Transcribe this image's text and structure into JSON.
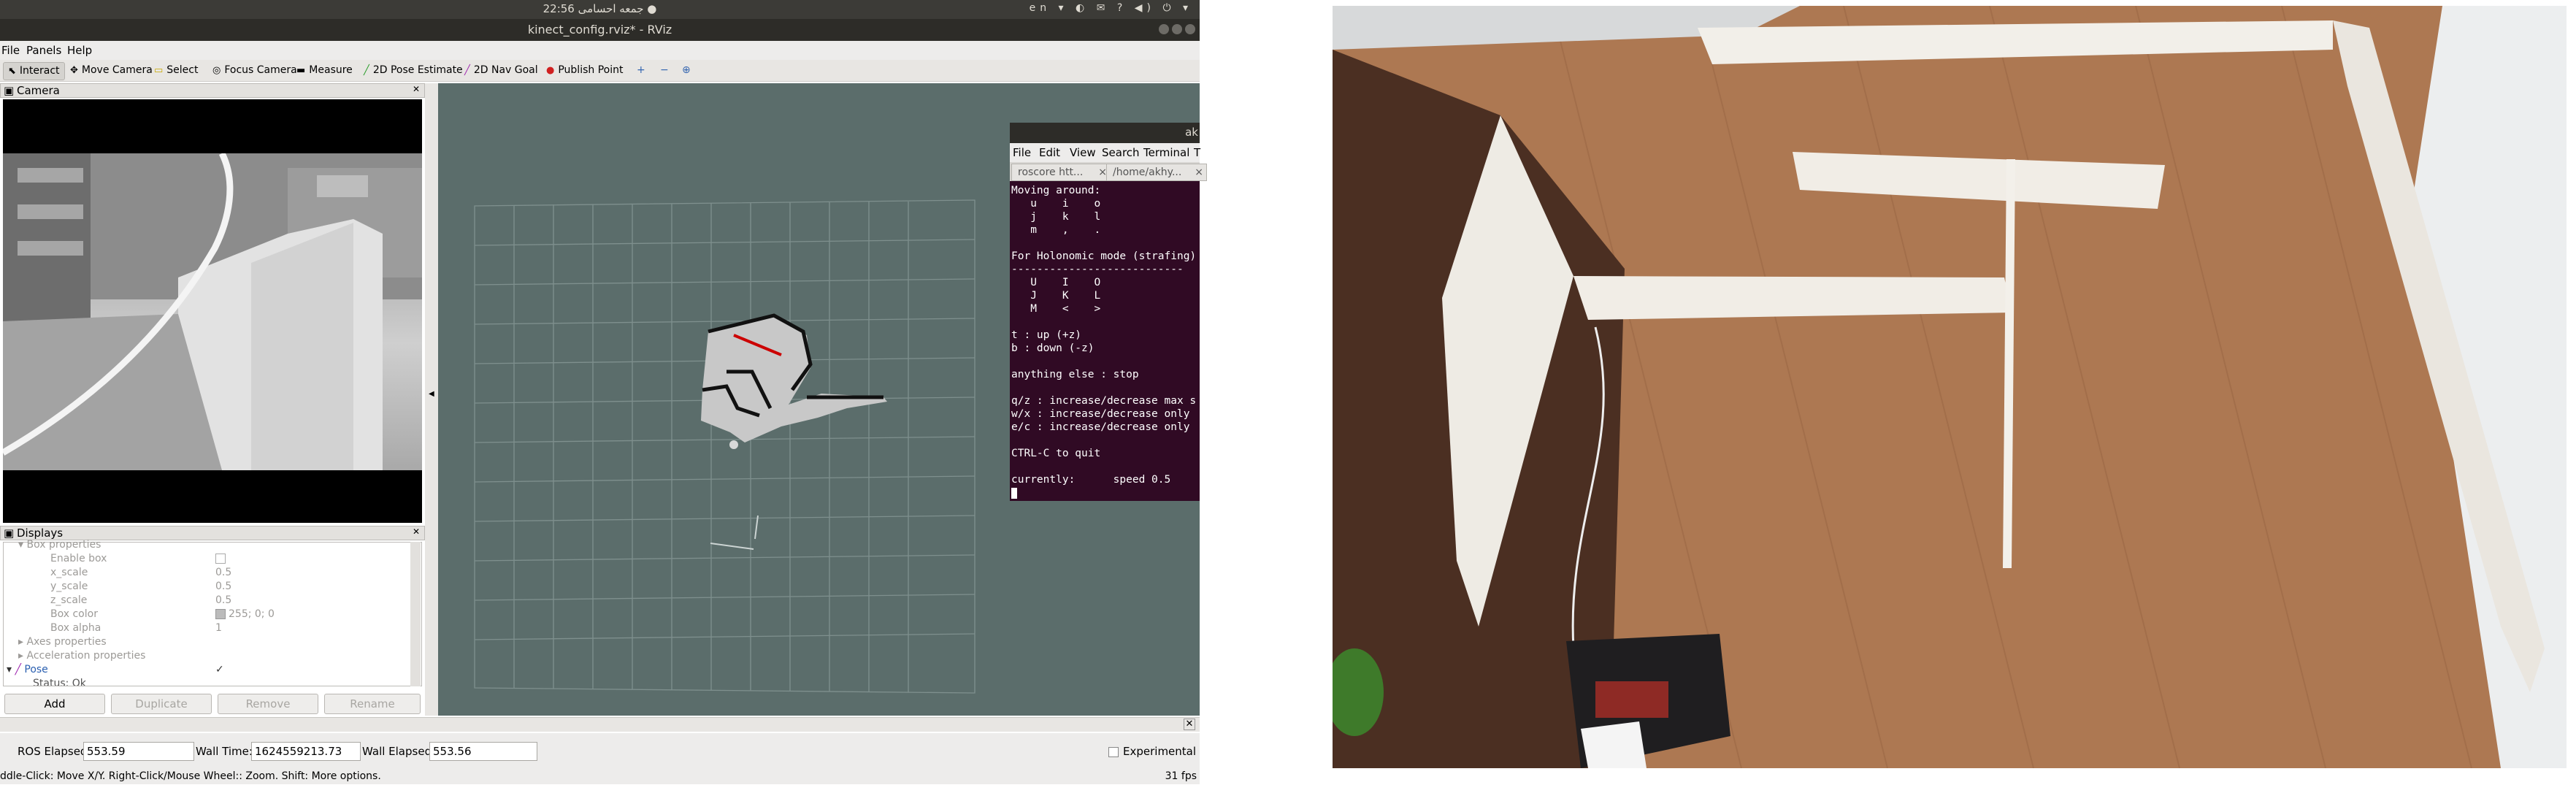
{
  "system": {
    "clock": "جمعه احسامی 22:56 ●",
    "lang": "en ▾",
    "tray": "◐ ✉ ? ◀) ⏻ ▾"
  },
  "window": {
    "title": "kinect_config.rviz* - RViz"
  },
  "menu": {
    "file": "File",
    "panels": "Panels",
    "help": "Help"
  },
  "toolbar": {
    "interact": "Interact",
    "move_camera": "Move Camera",
    "select": "Select",
    "focus_camera": "Focus Camera",
    "measure": "Measure",
    "pose_estimate": "2D Pose Estimate",
    "nav_goal": "2D Nav Goal",
    "publish_point": "Publish Point",
    "plus": "+",
    "minus": "−",
    "target": "⊕"
  },
  "camera_panel": {
    "title": "Camera"
  },
  "displays": {
    "title": "Displays",
    "rows": [
      {
        "label": "Box properties",
        "value": ""
      },
      {
        "label": "Enable box",
        "value": ""
      },
      {
        "label": "x_scale",
        "value": "0.5"
      },
      {
        "label": "y_scale",
        "value": "0.5"
      },
      {
        "label": "z_scale",
        "value": "0.5"
      },
      {
        "label": "Box color",
        "value": "255; 0; 0"
      },
      {
        "label": "Box alpha",
        "value": "1"
      },
      {
        "label": "Axes properties",
        "value": ""
      },
      {
        "label": "Acceleration properties",
        "value": ""
      },
      {
        "label": "Pose",
        "value": "✓"
      },
      {
        "label": "Status: Ok",
        "value": ""
      }
    ],
    "buttons": {
      "add": "Add",
      "duplicate": "Duplicate",
      "remove": "Remove",
      "rename": "Rename"
    }
  },
  "terminal": {
    "title": "ak",
    "menu": [
      "File",
      "Edit",
      "View",
      "Search",
      "Terminal",
      "T"
    ],
    "tabs": [
      "roscore htt...",
      "/home/akhy..."
    ],
    "lines": [
      "Moving around:",
      "   u    i    o",
      "   j    k    l",
      "   m    ,    .",
      "",
      "For Holonomic mode (strafing)",
      "---------------------------",
      "   U    I    O",
      "   J    K    L",
      "   M    <    >",
      "",
      "t : up (+z)",
      "b : down (-z)",
      "",
      "anything else : stop",
      "",
      "q/z : increase/decrease max s",
      "w/x : increase/decrease only",
      "e/c : increase/decrease only",
      "",
      "CTRL-C to quit",
      "",
      "currently:      speed 0.5"
    ]
  },
  "timebar": {
    "ros_elapsed_label": "ROS Elapsed:",
    "ros_elapsed": "553.59",
    "wall_time_label": "Wall Time:",
    "wall_time": "1624559213.73",
    "wall_elapsed_label": "Wall Elapsed:",
    "wall_elapsed": "553.56",
    "experimental": "Experimental"
  },
  "hint": {
    "text": "ddle-Click: Move X/Y. Right-Click/Mouse Wheel:: Zoom. Shift: More options.",
    "fps": "31 fps"
  },
  "colors": {
    "grid_bg": "#5b6d6b",
    "terminal_bg": "#300a24",
    "pose_arrow": "#cc0000"
  }
}
